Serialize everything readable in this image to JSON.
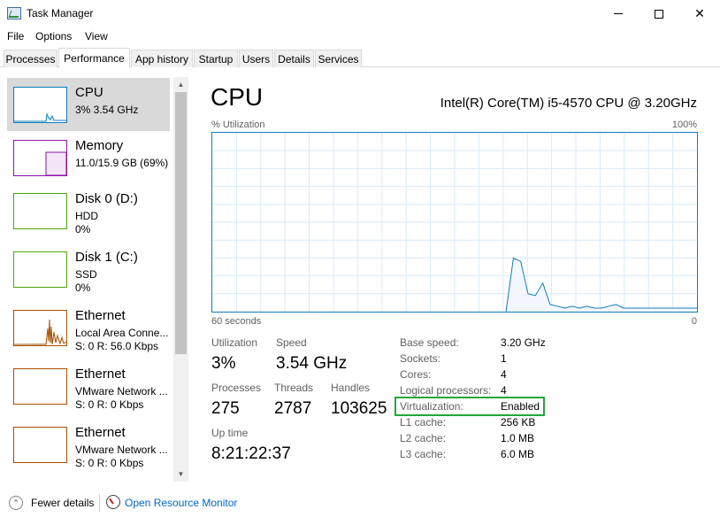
{
  "window": {
    "title": "Task Manager"
  },
  "menu": [
    "File",
    "Options",
    "View"
  ],
  "tabs": [
    "Processes",
    "Performance",
    "App history",
    "Startup",
    "Users",
    "Details",
    "Services"
  ],
  "active_tab": "Performance",
  "resources": [
    {
      "title": "CPU",
      "sub1": "3%  3.54 GHz",
      "sub2": "",
      "color": "#117dbb"
    },
    {
      "title": "Memory",
      "sub1": "11.0/15.9 GB (69%)",
      "sub2": "",
      "color": "#8b12ae"
    },
    {
      "title": "Disk 0 (D:)",
      "sub1": "HDD",
      "sub2": "0%",
      "color": "#4da60c"
    },
    {
      "title": "Disk 1 (C:)",
      "sub1": "SSD",
      "sub2": "0%",
      "color": "#4da60c"
    },
    {
      "title": "Ethernet",
      "sub1": "Local Area Conne...",
      "sub2": "S: 0 R: 56.0 Kbps",
      "color": "#a74f01"
    },
    {
      "title": "Ethernet",
      "sub1": "VMware Network ...",
      "sub2": "S: 0 R: 0 Kbps",
      "color": "#a74f01"
    },
    {
      "title": "Ethernet",
      "sub1": "VMware Network ...",
      "sub2": "S: 0 R: 0 Kbps",
      "color": "#a74f01"
    }
  ],
  "cpu": {
    "title": "CPU",
    "model": "Intel(R) Core(TM) i5-4570 CPU @ 3.20GHz",
    "graph_label": "% Utilization",
    "graph_max": "100%",
    "axis_left": "60 seconds",
    "axis_right": "0",
    "graph_color": "#117dbb",
    "stats": {
      "utilization_label": "Utilization",
      "utilization": "3%",
      "speed_label": "Speed",
      "speed": "3.54 GHz",
      "processes_label": "Processes",
      "processes": "275",
      "threads_label": "Threads",
      "threads": "2787",
      "handles_label": "Handles",
      "handles": "103625",
      "uptime_label": "Up time",
      "uptime": "8:21:22:37"
    },
    "specs": [
      {
        "label": "Base speed:",
        "value": "3.20 GHz"
      },
      {
        "label": "Sockets:",
        "value": "1"
      },
      {
        "label": "Cores:",
        "value": "4"
      },
      {
        "label": "Logical processors:",
        "value": "4"
      },
      {
        "label": "Virtualization:",
        "value": "Enabled"
      },
      {
        "label": "L1 cache:",
        "value": "256 KB"
      },
      {
        "label": "L2 cache:",
        "value": "1.0 MB"
      },
      {
        "label": "L3 cache:",
        "value": "6.0 MB"
      }
    ],
    "utilization_history": [
      0,
      0,
      0,
      0,
      0,
      0,
      0,
      0,
      0,
      0,
      0,
      0,
      0,
      0,
      0,
      0,
      0,
      0,
      0,
      0,
      0,
      0,
      0,
      0,
      0,
      0,
      0,
      0,
      0,
      0,
      0,
      0,
      0,
      0,
      0,
      0,
      0,
      0,
      0,
      0,
      0,
      30,
      28,
      10,
      9,
      16,
      4,
      3,
      2,
      3,
      2,
      3,
      2,
      2,
      3,
      4,
      2,
      2,
      2,
      2,
      2,
      2,
      2,
      2,
      2,
      2,
      2
    ]
  },
  "footer": {
    "fewer_details": "Fewer details",
    "open_resmon": "Open Resource Monitor"
  }
}
